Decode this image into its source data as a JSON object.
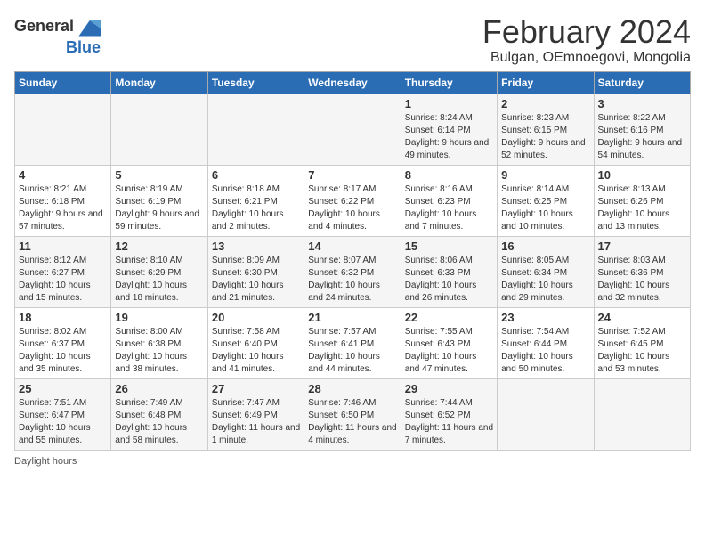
{
  "header": {
    "logo_general": "General",
    "logo_blue": "Blue",
    "title": "February 2024",
    "subtitle": "Bulgan, OEmnoegovi, Mongolia"
  },
  "days_of_week": [
    "Sunday",
    "Monday",
    "Tuesday",
    "Wednesday",
    "Thursday",
    "Friday",
    "Saturday"
  ],
  "weeks": [
    [
      {
        "day": "",
        "info": ""
      },
      {
        "day": "",
        "info": ""
      },
      {
        "day": "",
        "info": ""
      },
      {
        "day": "",
        "info": ""
      },
      {
        "day": "1",
        "info": "Sunrise: 8:24 AM\nSunset: 6:14 PM\nDaylight: 9 hours and 49 minutes."
      },
      {
        "day": "2",
        "info": "Sunrise: 8:23 AM\nSunset: 6:15 PM\nDaylight: 9 hours and 52 minutes."
      },
      {
        "day": "3",
        "info": "Sunrise: 8:22 AM\nSunset: 6:16 PM\nDaylight: 9 hours and 54 minutes."
      }
    ],
    [
      {
        "day": "4",
        "info": "Sunrise: 8:21 AM\nSunset: 6:18 PM\nDaylight: 9 hours and 57 minutes."
      },
      {
        "day": "5",
        "info": "Sunrise: 8:19 AM\nSunset: 6:19 PM\nDaylight: 9 hours and 59 minutes."
      },
      {
        "day": "6",
        "info": "Sunrise: 8:18 AM\nSunset: 6:21 PM\nDaylight: 10 hours and 2 minutes."
      },
      {
        "day": "7",
        "info": "Sunrise: 8:17 AM\nSunset: 6:22 PM\nDaylight: 10 hours and 4 minutes."
      },
      {
        "day": "8",
        "info": "Sunrise: 8:16 AM\nSunset: 6:23 PM\nDaylight: 10 hours and 7 minutes."
      },
      {
        "day": "9",
        "info": "Sunrise: 8:14 AM\nSunset: 6:25 PM\nDaylight: 10 hours and 10 minutes."
      },
      {
        "day": "10",
        "info": "Sunrise: 8:13 AM\nSunset: 6:26 PM\nDaylight: 10 hours and 13 minutes."
      }
    ],
    [
      {
        "day": "11",
        "info": "Sunrise: 8:12 AM\nSunset: 6:27 PM\nDaylight: 10 hours and 15 minutes."
      },
      {
        "day": "12",
        "info": "Sunrise: 8:10 AM\nSunset: 6:29 PM\nDaylight: 10 hours and 18 minutes."
      },
      {
        "day": "13",
        "info": "Sunrise: 8:09 AM\nSunset: 6:30 PM\nDaylight: 10 hours and 21 minutes."
      },
      {
        "day": "14",
        "info": "Sunrise: 8:07 AM\nSunset: 6:32 PM\nDaylight: 10 hours and 24 minutes."
      },
      {
        "day": "15",
        "info": "Sunrise: 8:06 AM\nSunset: 6:33 PM\nDaylight: 10 hours and 26 minutes."
      },
      {
        "day": "16",
        "info": "Sunrise: 8:05 AM\nSunset: 6:34 PM\nDaylight: 10 hours and 29 minutes."
      },
      {
        "day": "17",
        "info": "Sunrise: 8:03 AM\nSunset: 6:36 PM\nDaylight: 10 hours and 32 minutes."
      }
    ],
    [
      {
        "day": "18",
        "info": "Sunrise: 8:02 AM\nSunset: 6:37 PM\nDaylight: 10 hours and 35 minutes."
      },
      {
        "day": "19",
        "info": "Sunrise: 8:00 AM\nSunset: 6:38 PM\nDaylight: 10 hours and 38 minutes."
      },
      {
        "day": "20",
        "info": "Sunrise: 7:58 AM\nSunset: 6:40 PM\nDaylight: 10 hours and 41 minutes."
      },
      {
        "day": "21",
        "info": "Sunrise: 7:57 AM\nSunset: 6:41 PM\nDaylight: 10 hours and 44 minutes."
      },
      {
        "day": "22",
        "info": "Sunrise: 7:55 AM\nSunset: 6:43 PM\nDaylight: 10 hours and 47 minutes."
      },
      {
        "day": "23",
        "info": "Sunrise: 7:54 AM\nSunset: 6:44 PM\nDaylight: 10 hours and 50 minutes."
      },
      {
        "day": "24",
        "info": "Sunrise: 7:52 AM\nSunset: 6:45 PM\nDaylight: 10 hours and 53 minutes."
      }
    ],
    [
      {
        "day": "25",
        "info": "Sunrise: 7:51 AM\nSunset: 6:47 PM\nDaylight: 10 hours and 55 minutes."
      },
      {
        "day": "26",
        "info": "Sunrise: 7:49 AM\nSunset: 6:48 PM\nDaylight: 10 hours and 58 minutes."
      },
      {
        "day": "27",
        "info": "Sunrise: 7:47 AM\nSunset: 6:49 PM\nDaylight: 11 hours and 1 minute."
      },
      {
        "day": "28",
        "info": "Sunrise: 7:46 AM\nSunset: 6:50 PM\nDaylight: 11 hours and 4 minutes."
      },
      {
        "day": "29",
        "info": "Sunrise: 7:44 AM\nSunset: 6:52 PM\nDaylight: 11 hours and 7 minutes."
      },
      {
        "day": "",
        "info": ""
      },
      {
        "day": "",
        "info": ""
      }
    ]
  ],
  "footer": {
    "daylight_label": "Daylight hours"
  }
}
